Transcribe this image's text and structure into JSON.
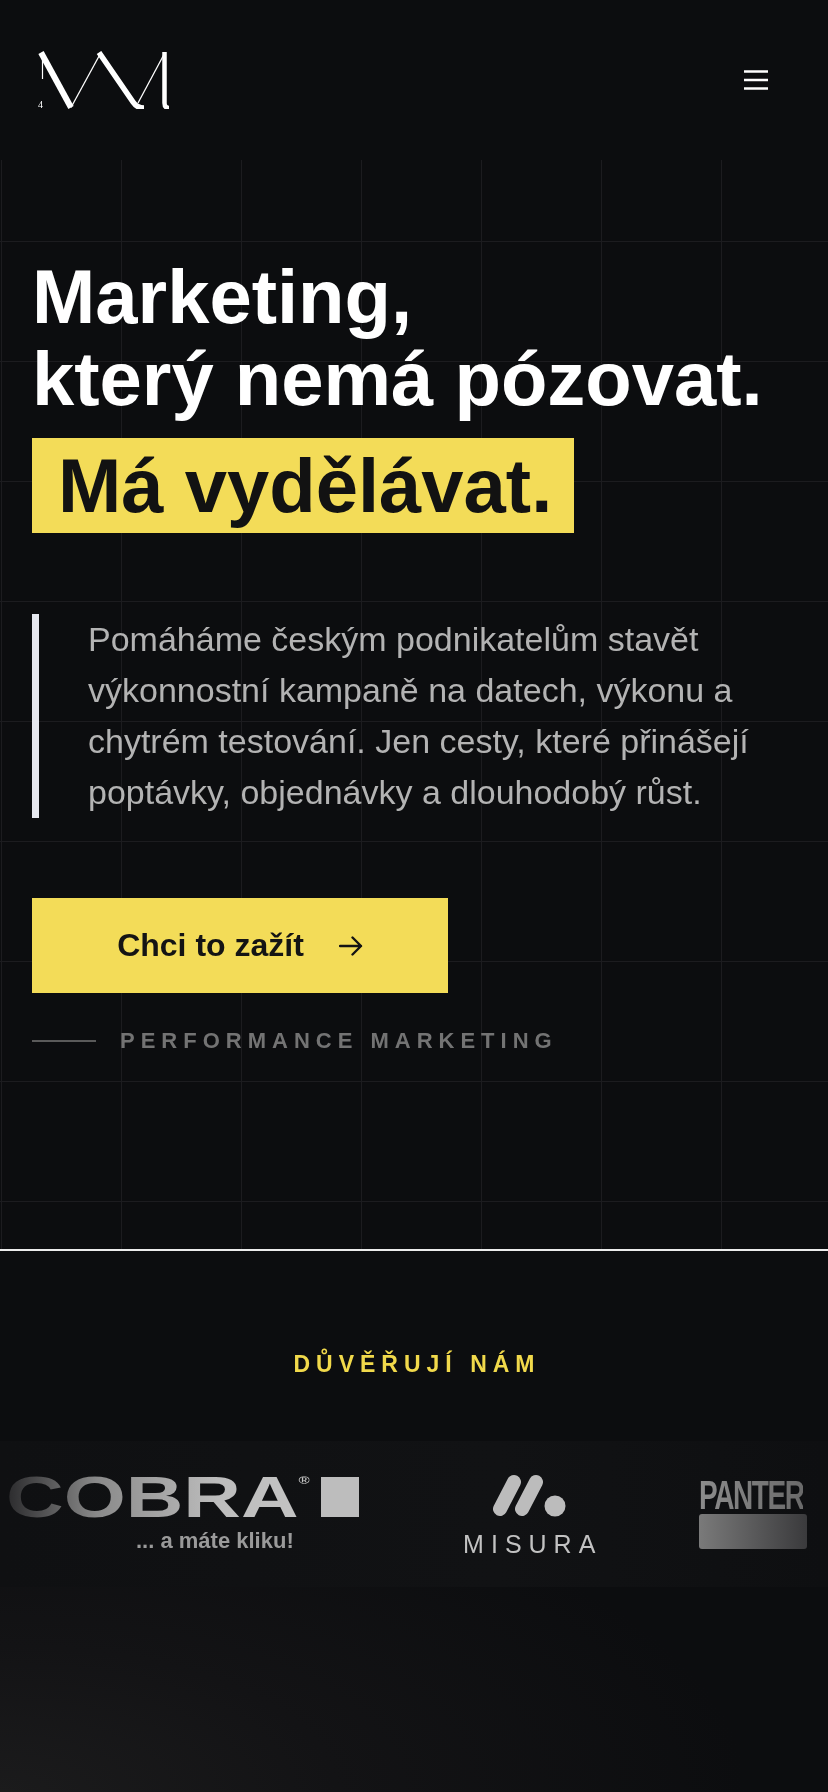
{
  "header": {
    "logo_digit": "4"
  },
  "hero": {
    "headline_lines": [
      "Marketing,",
      "který nemá pózovat."
    ],
    "highlight": "Má vydělávat.",
    "intro": "Pomáháme českým podnikatelům stavět výkonnostní kampaně na datech, výkonu a chytrém testování. Jen cesty, které přinášejí poptávky, objednávky a dlouhodobý růst.",
    "cta": {
      "label": "Chci to zažít"
    },
    "tagline": "PERFORMANCE MARKETING"
  },
  "clients": {
    "title": "DŮVĚŘUJÍ NÁM",
    "logos": [
      {
        "kind": "wordmark-tagline",
        "name": "COBRA$^{®}$",
        "tagline": "... a máte kliku!"
      },
      {
        "kind": "icon-wordmark",
        "name": "MISURA"
      },
      {
        "kind": "wordmark-bar",
        "name": "PANTER"
      }
    ]
  }
}
